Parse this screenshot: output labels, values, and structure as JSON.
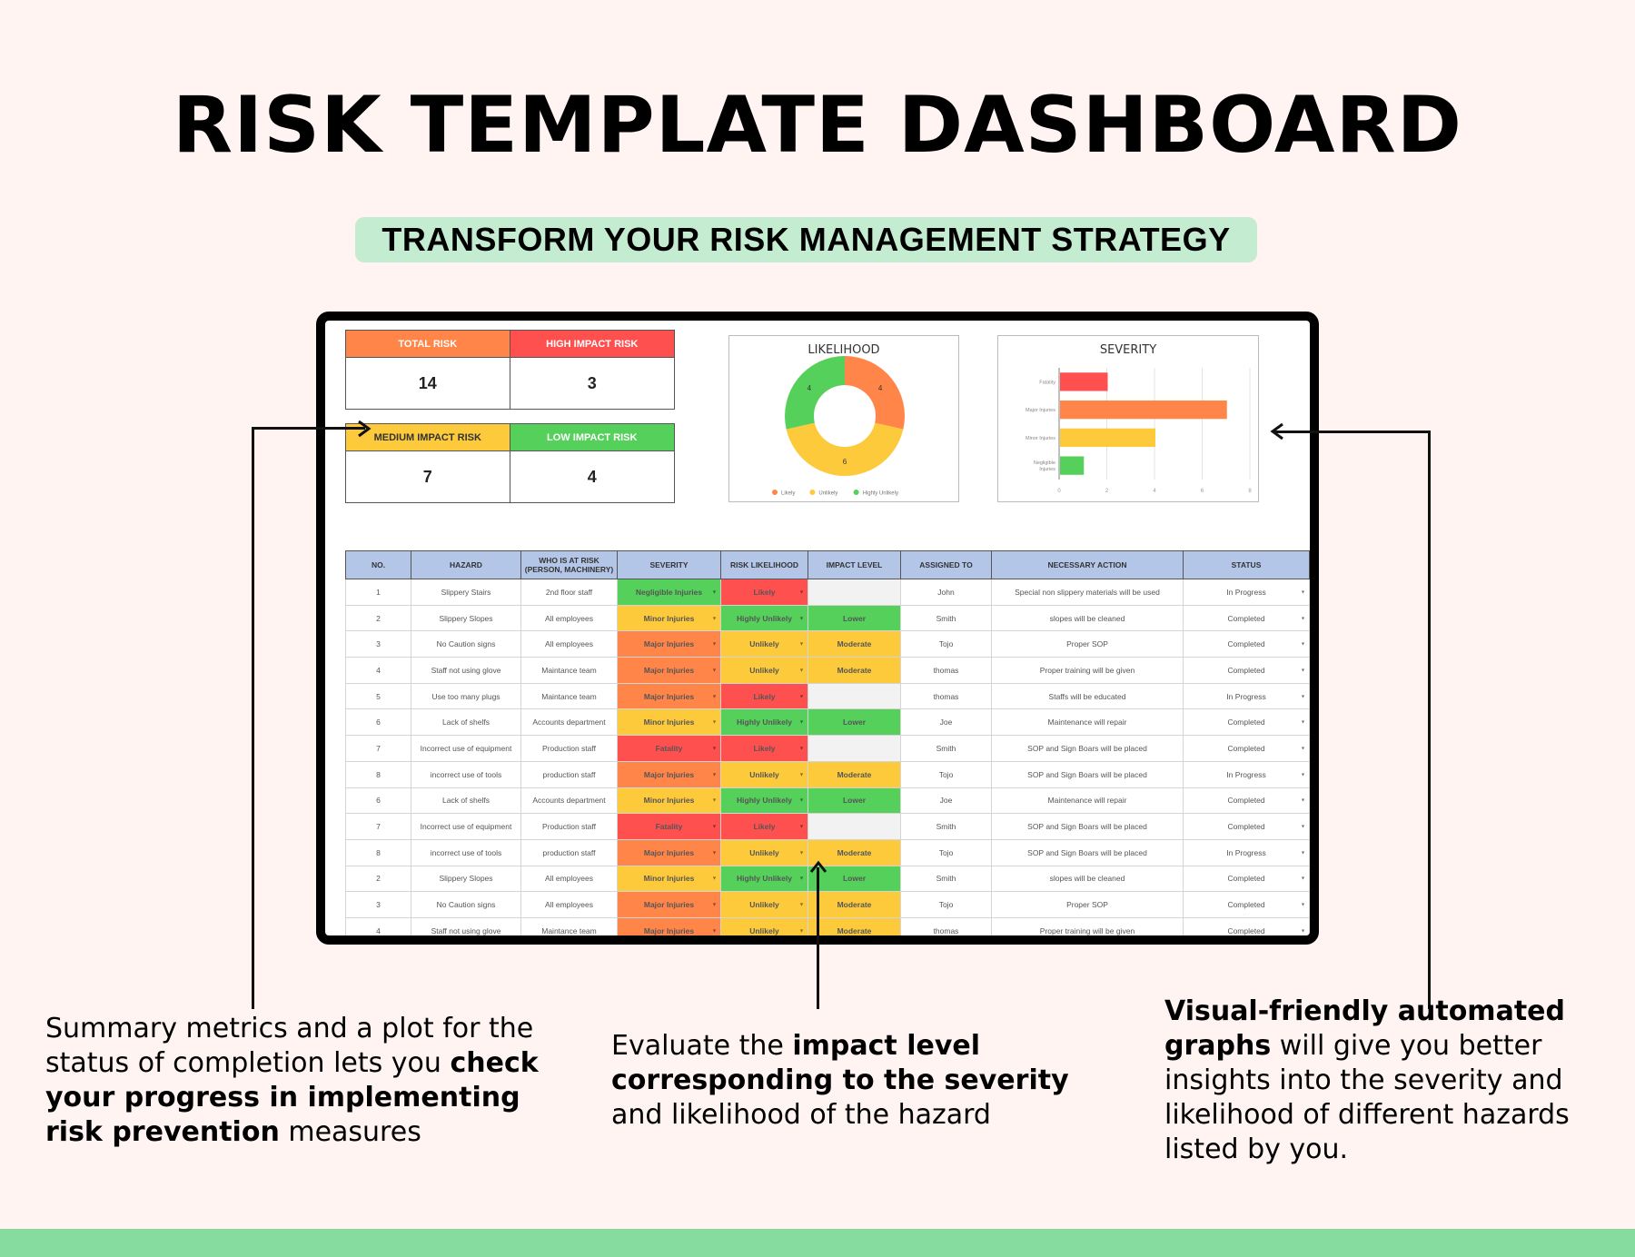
{
  "header": {
    "title": "RISK TEMPLATE DASHBOARD",
    "subtitle": "TRANSFORM YOUR RISK MANAGEMENT STRATEGY"
  },
  "colors": {
    "orange": "#ff8548",
    "red": "#ff5050",
    "yellow": "#fdca3c",
    "green": "#55d05a",
    "header_blue": "#b4c6e7",
    "pill_green": "#c4ecd0",
    "footer_green": "#86db9e",
    "background": "#fff4f2"
  },
  "kpis": {
    "total_risk": {
      "label": "TOTAL RISK",
      "value": "14"
    },
    "high_impact": {
      "label": "HIGH IMPACT RISK",
      "value": "3"
    },
    "medium_impact": {
      "label": "MEDIUM IMPACT RISK",
      "value": "7"
    },
    "low_impact": {
      "label": "LOW IMPACT RISK",
      "value": "4"
    }
  },
  "chart_data": [
    {
      "type": "pie",
      "variant": "donut",
      "title": "LIKELIHOOD",
      "categories": [
        "Likely",
        "Unlikely",
        "Highly Unlikely"
      ],
      "values": [
        4,
        6,
        4
      ],
      "colors": [
        "#ff8548",
        "#fdca3c",
        "#55d05a"
      ],
      "legend": "bottom"
    },
    {
      "type": "bar",
      "orientation": "horizontal",
      "title": "SEVERITY",
      "categories": [
        "Fatality",
        "Major Injuries",
        "Minor Injuries",
        "Negligible Injuries"
      ],
      "values": [
        2,
        7,
        4,
        1
      ],
      "colors": [
        "#ff5050",
        "#ff8548",
        "#fdca3c",
        "#55d05a"
      ],
      "xlim": [
        0,
        8
      ],
      "xticks": [
        "0",
        "2",
        "4",
        "6",
        "8"
      ],
      "grid": true
    }
  ],
  "table": {
    "columns": [
      "NO.",
      "HAZARD",
      "WHO IS AT RISK (PERSON, MACHINERY)",
      "SEVERITY",
      "RISK LIKELIHOOD",
      "IMPACT LEVEL",
      "ASSIGNED TO",
      "NECESSARY ACTION",
      "STATUS"
    ],
    "rows": [
      {
        "no": "1",
        "hazard": "Slippery Stairs",
        "who": "2nd floor staff",
        "severity": "Negligible Injuries",
        "likelihood": "Likely",
        "impact": "",
        "assigned": "John",
        "action": "Special non slippery materials will be used",
        "status": "In Progress"
      },
      {
        "no": "2",
        "hazard": "Slippery Slopes",
        "who": "All employees",
        "severity": "Minor Injuries",
        "likelihood": "Highly Unlikely",
        "impact": "Lower",
        "assigned": "Smith",
        "action": "slopes will be cleaned",
        "status": "Completed"
      },
      {
        "no": "3",
        "hazard": "No Caution signs",
        "who": "All employees",
        "severity": "Major Injuries",
        "likelihood": "Unlikely",
        "impact": "Moderate",
        "assigned": "Tojo",
        "action": "Proper SOP",
        "status": "Completed"
      },
      {
        "no": "4",
        "hazard": "Staff not using glove",
        "who": "Maintance team",
        "severity": "Major Injuries",
        "likelihood": "Unlikely",
        "impact": "Moderate",
        "assigned": "thomas",
        "action": "Proper training will be given",
        "status": "Completed"
      },
      {
        "no": "5",
        "hazard": "Use too many plugs",
        "who": "Maintance team",
        "severity": "Major Injuries",
        "likelihood": "Likely",
        "impact": "",
        "assigned": "thomas",
        "action": "Staffs will be educated",
        "status": "In Progress"
      },
      {
        "no": "6",
        "hazard": "Lack of shelfs",
        "who": "Accounts department",
        "severity": "Minor Injuries",
        "likelihood": "Highly Unlikely",
        "impact": "Lower",
        "assigned": "Joe",
        "action": "Maintenance will repair",
        "status": "Completed"
      },
      {
        "no": "7",
        "hazard": "Incorrect use of equipment",
        "who": "Production staff",
        "severity": "Fatality",
        "likelihood": "Likely",
        "impact": "",
        "assigned": "Smith",
        "action": "SOP and Sign Boars will be placed",
        "status": "Completed"
      },
      {
        "no": "8",
        "hazard": "incorrect use of tools",
        "who": "production staff",
        "severity": "Major Injuries",
        "likelihood": "Unlikely",
        "impact": "Moderate",
        "assigned": "Tojo",
        "action": "SOP and Sign Boars will be placed",
        "status": "In Progress"
      },
      {
        "no": "6",
        "hazard": "Lack of shelfs",
        "who": "Accounts department",
        "severity": "Minor Injuries",
        "likelihood": "Highly Unlikely",
        "impact": "Lower",
        "assigned": "Joe",
        "action": "Maintenance will repair",
        "status": "Completed"
      },
      {
        "no": "7",
        "hazard": "Incorrect use of equipment",
        "who": "Production staff",
        "severity": "Fatality",
        "likelihood": "Likely",
        "impact": "",
        "assigned": "Smith",
        "action": "SOP and Sign Boars will be placed",
        "status": "Completed"
      },
      {
        "no": "8",
        "hazard": "incorrect use of tools",
        "who": "production staff",
        "severity": "Major Injuries",
        "likelihood": "Unlikely",
        "impact": "Moderate",
        "assigned": "Tojo",
        "action": "SOP and Sign Boars will be placed",
        "status": "In Progress"
      },
      {
        "no": "2",
        "hazard": "Slippery Slopes",
        "who": "All employees",
        "severity": "Minor Injuries",
        "likelihood": "Highly Unlikely",
        "impact": "Lower",
        "assigned": "Smith",
        "action": "slopes will be cleaned",
        "status": "Completed"
      },
      {
        "no": "3",
        "hazard": "No Caution signs",
        "who": "All employees",
        "severity": "Major Injuries",
        "likelihood": "Unlikely",
        "impact": "Moderate",
        "assigned": "Tojo",
        "action": "Proper SOP",
        "status": "Completed"
      },
      {
        "no": "4",
        "hazard": "Staff not using glove",
        "who": "Maintance team",
        "severity": "Major Injuries",
        "likelihood": "Unlikely",
        "impact": "Moderate",
        "assigned": "thomas",
        "action": "Proper training will be given",
        "status": "Completed"
      }
    ],
    "dropdown_glyph": "▾"
  },
  "notes": {
    "left": {
      "p1": " Summary metrics and a  plot for the status of completion lets you ",
      "bold": "check your progress in implementing risk prevention",
      "p2": " measures"
    },
    "middle": {
      "p1": "Evaluate the ",
      "bold": "impact level corresponding to the severity",
      "p2": " and likelihood of the hazard"
    },
    "right": {
      "bold": "Visual-friendly automated graphs",
      "p2": " will give you better insights into the severity and likelihood of different hazards listed by you."
    }
  }
}
